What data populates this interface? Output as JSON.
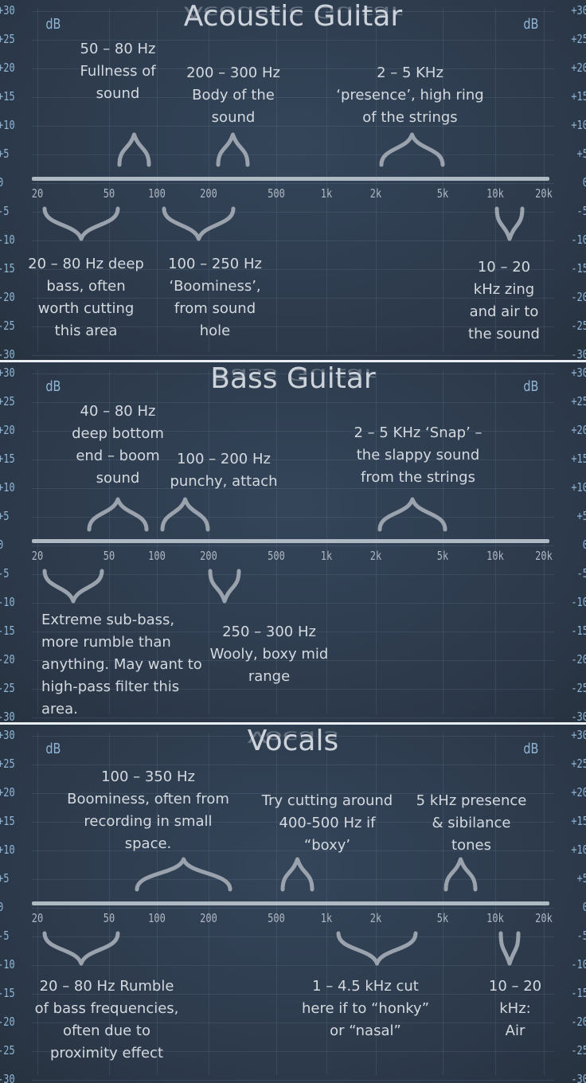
{
  "panels": [
    {
      "title": "Acoustic Guitar",
      "db_label": "dB",
      "y_ticks": [
        "+30",
        "+25",
        "+20",
        "+15",
        "+10",
        "+5",
        "0",
        "-5",
        "-10",
        "-15",
        "-20",
        "-25",
        "-30"
      ],
      "x_ticks": [
        "20",
        "50",
        "100",
        "200",
        "500",
        "1k",
        "2k",
        "5k",
        "10k",
        "20k"
      ],
      "annotations": [
        {
          "type": "boost",
          "lines": [
            "50 – 80 Hz",
            "Fullness of",
            "sound"
          ]
        },
        {
          "type": "boost",
          "lines": [
            "200 – 300 Hz",
            "Body of the",
            "sound"
          ]
        },
        {
          "type": "boost",
          "lines": [
            "2 – 5 KHz",
            "‘presence’, high ring",
            "of the strings"
          ]
        },
        {
          "type": "cut",
          "lines": [
            "20 – 80 Hz deep",
            "bass, often",
            "worth cutting",
            "this area"
          ]
        },
        {
          "type": "cut",
          "lines": [
            "100 – 250 Hz",
            "‘Boominess’,",
            "from sound",
            "hole"
          ]
        },
        {
          "type": "cut",
          "lines": [
            "10 – 20",
            "kHz zing",
            "and air to",
            "the sound"
          ]
        }
      ]
    },
    {
      "title": "Bass Guitar",
      "db_label": "dB",
      "y_ticks": [
        "+30",
        "+25",
        "+20",
        "+15",
        "+10",
        "+5",
        "0",
        "-5",
        "-10",
        "-15",
        "-20",
        "-25",
        "-30"
      ],
      "x_ticks": [
        "20",
        "50",
        "100",
        "200",
        "500",
        "1k",
        "2k",
        "5k",
        "10k",
        "20k"
      ],
      "annotations": [
        {
          "type": "boost",
          "lines": [
            "40 – 80 Hz",
            "deep bottom",
            "end – boom",
            "sound"
          ]
        },
        {
          "type": "boost",
          "lines": [
            "100 – 200 Hz",
            "punchy, attach"
          ]
        },
        {
          "type": "boost",
          "lines": [
            "2 – 5 KHz ‘Snap’ –",
            "the slappy sound",
            "from the strings"
          ]
        },
        {
          "type": "cut",
          "lines": [
            "Extreme sub-bass,",
            "more rumble than",
            "anything. May want to",
            "high-pass filter this",
            "area."
          ]
        },
        {
          "type": "cut",
          "lines": [
            "250 – 300 Hz",
            "Wooly, boxy mid",
            "range"
          ]
        }
      ]
    },
    {
      "title": "Vocals",
      "db_label": "dB",
      "y_ticks": [
        "+30",
        "+25",
        "+20",
        "+15",
        "+10",
        "+5",
        "0",
        "-5",
        "-10",
        "-15",
        "-20",
        "-25",
        "-30"
      ],
      "x_ticks": [
        "20",
        "50",
        "100",
        "200",
        "500",
        "1k",
        "2k",
        "5k",
        "10k",
        "20k"
      ],
      "annotations": [
        {
          "type": "boost",
          "lines": [
            "100 – 350 Hz",
            "Boominess, often from",
            "recording in small",
            "space."
          ]
        },
        {
          "type": "boost",
          "lines": [
            "Try cutting around",
            "400-500 Hz if",
            "“boxy’"
          ]
        },
        {
          "type": "boost",
          "lines": [
            "5 kHz presence",
            "& sibilance",
            "tones"
          ]
        },
        {
          "type": "cut",
          "lines": [
            "20 – 80 Hz Rumble",
            "of bass frequencies,",
            "often due to",
            "proximity effect"
          ]
        },
        {
          "type": "cut",
          "lines": [
            "1 – 4.5 kHz cut",
            "here if to “honky”",
            "or “nasal”"
          ]
        },
        {
          "type": "cut",
          "lines": [
            "10 – 20",
            "kHz:",
            "Air"
          ]
        }
      ]
    }
  ]
}
